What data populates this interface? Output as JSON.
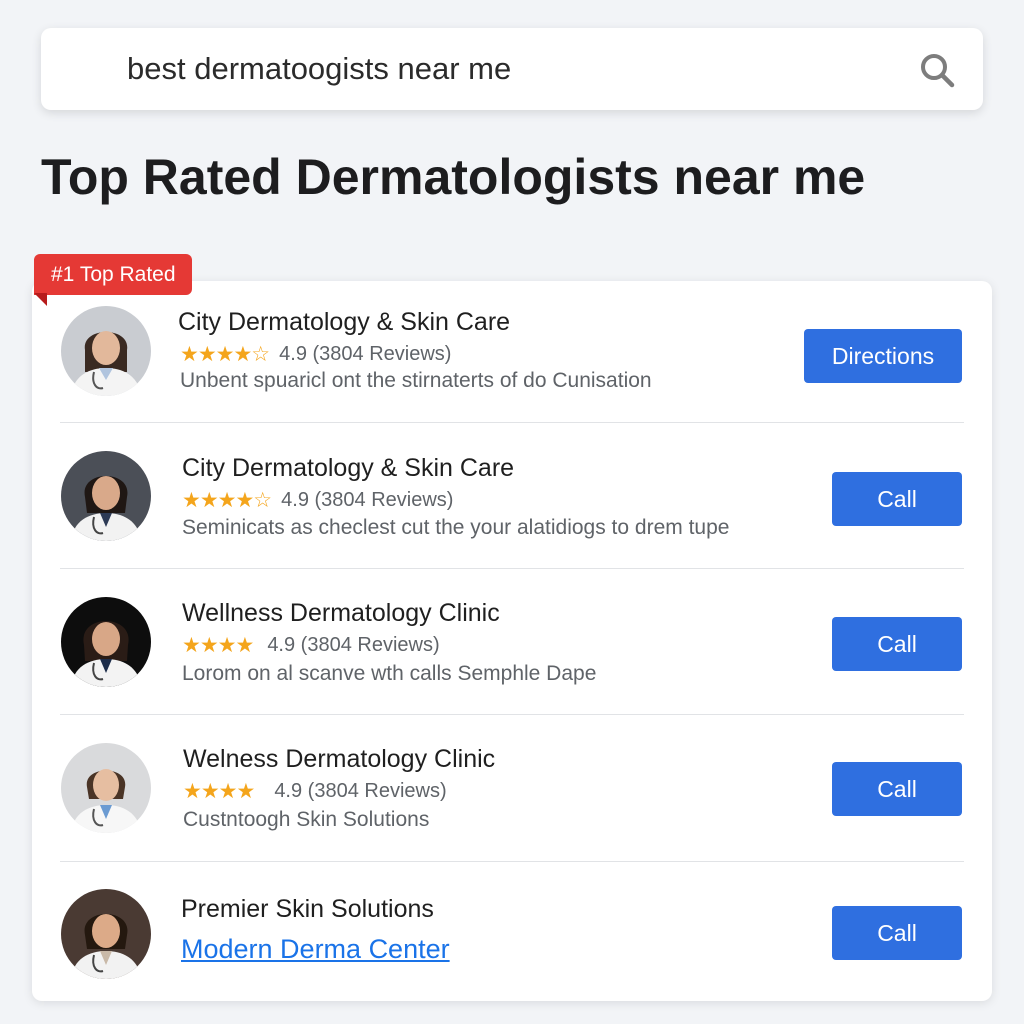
{
  "search": {
    "query": "best dermatoogists near me",
    "icon": "search-icon"
  },
  "page_title": "Top Rated Dermatologists near me",
  "badge": {
    "label": "#1 Top Rated",
    "color": "#e53935"
  },
  "colors": {
    "accent": "#2f6fe0",
    "star": "#f4a51c",
    "link": "#1a73e8"
  },
  "results": [
    {
      "name": "City Dermatology & Skin Care",
      "stars": "★★★★☆",
      "rating": "4.9 (3804 Reviews)",
      "description": "Unbent spuaricl ont the stirnaterts of do Cunisation",
      "button": "Directions"
    },
    {
      "name": "City Dermatology & Skin Care",
      "stars": "★★★★☆",
      "rating": "4.9 (3804 Reviews)",
      "description": "Seminicats as checlest cut the your alatidiogs to drem tupe",
      "button": "Call"
    },
    {
      "name": "Wellness Dermatology Clinic",
      "stars": "★★★★",
      "rating": "4.9 (3804 Reviews)",
      "description": "Lorom on al scanve wth calls Semphle Dape",
      "button": "Call"
    },
    {
      "name": "Welness Dermatology Clinic",
      "stars": "★★★★",
      "rating": "4.9 (3804 Reviews)",
      "description": "Custntoogh Skin Solutions",
      "button": "Call"
    },
    {
      "name": "Premier Skin Solutions",
      "link": "Modern Derma Center",
      "button": "Call"
    }
  ]
}
